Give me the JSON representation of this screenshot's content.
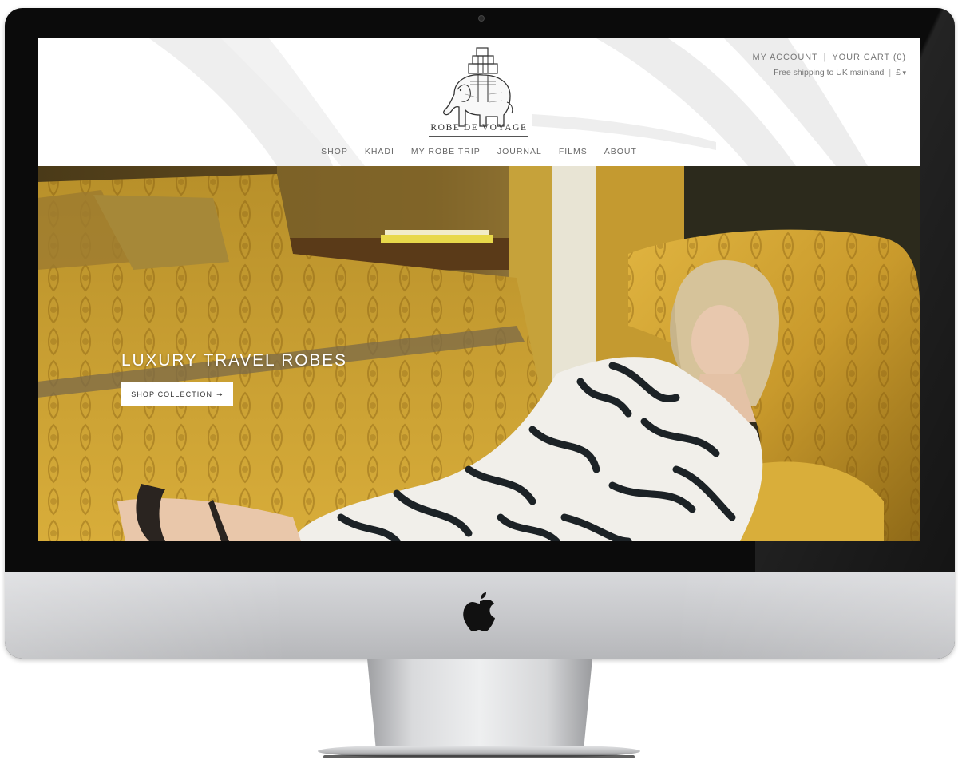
{
  "brand": {
    "name": "ROBE DE VOYAGE",
    "logo_icon": "elephant-with-luggage-icon"
  },
  "header": {
    "account_label": "MY ACCOUNT",
    "cart_label": "YOUR CART (0)",
    "shipping_note": "Free shipping to UK mainland",
    "currency": "£",
    "currency_icon": "caret-down-icon"
  },
  "nav": {
    "items": [
      {
        "label": "SHOP"
      },
      {
        "label": "KHADI"
      },
      {
        "label": "MY ROBE TRIP"
      },
      {
        "label": "JOURNAL"
      },
      {
        "label": "FILMS"
      },
      {
        "label": "ABOUT"
      }
    ]
  },
  "hero": {
    "title": "LUXURY TRAVEL ROBES",
    "cta_label": "SHOP COLLECTION",
    "cta_icon": "arrow-right-icon"
  },
  "colors": {
    "hero_gold": "#c9a237",
    "bezel": "#0b0b0b",
    "chin": "#c6c7ca",
    "nav_text": "#666666"
  },
  "device": {
    "type": "iMac",
    "logo_icon": "apple-icon"
  }
}
